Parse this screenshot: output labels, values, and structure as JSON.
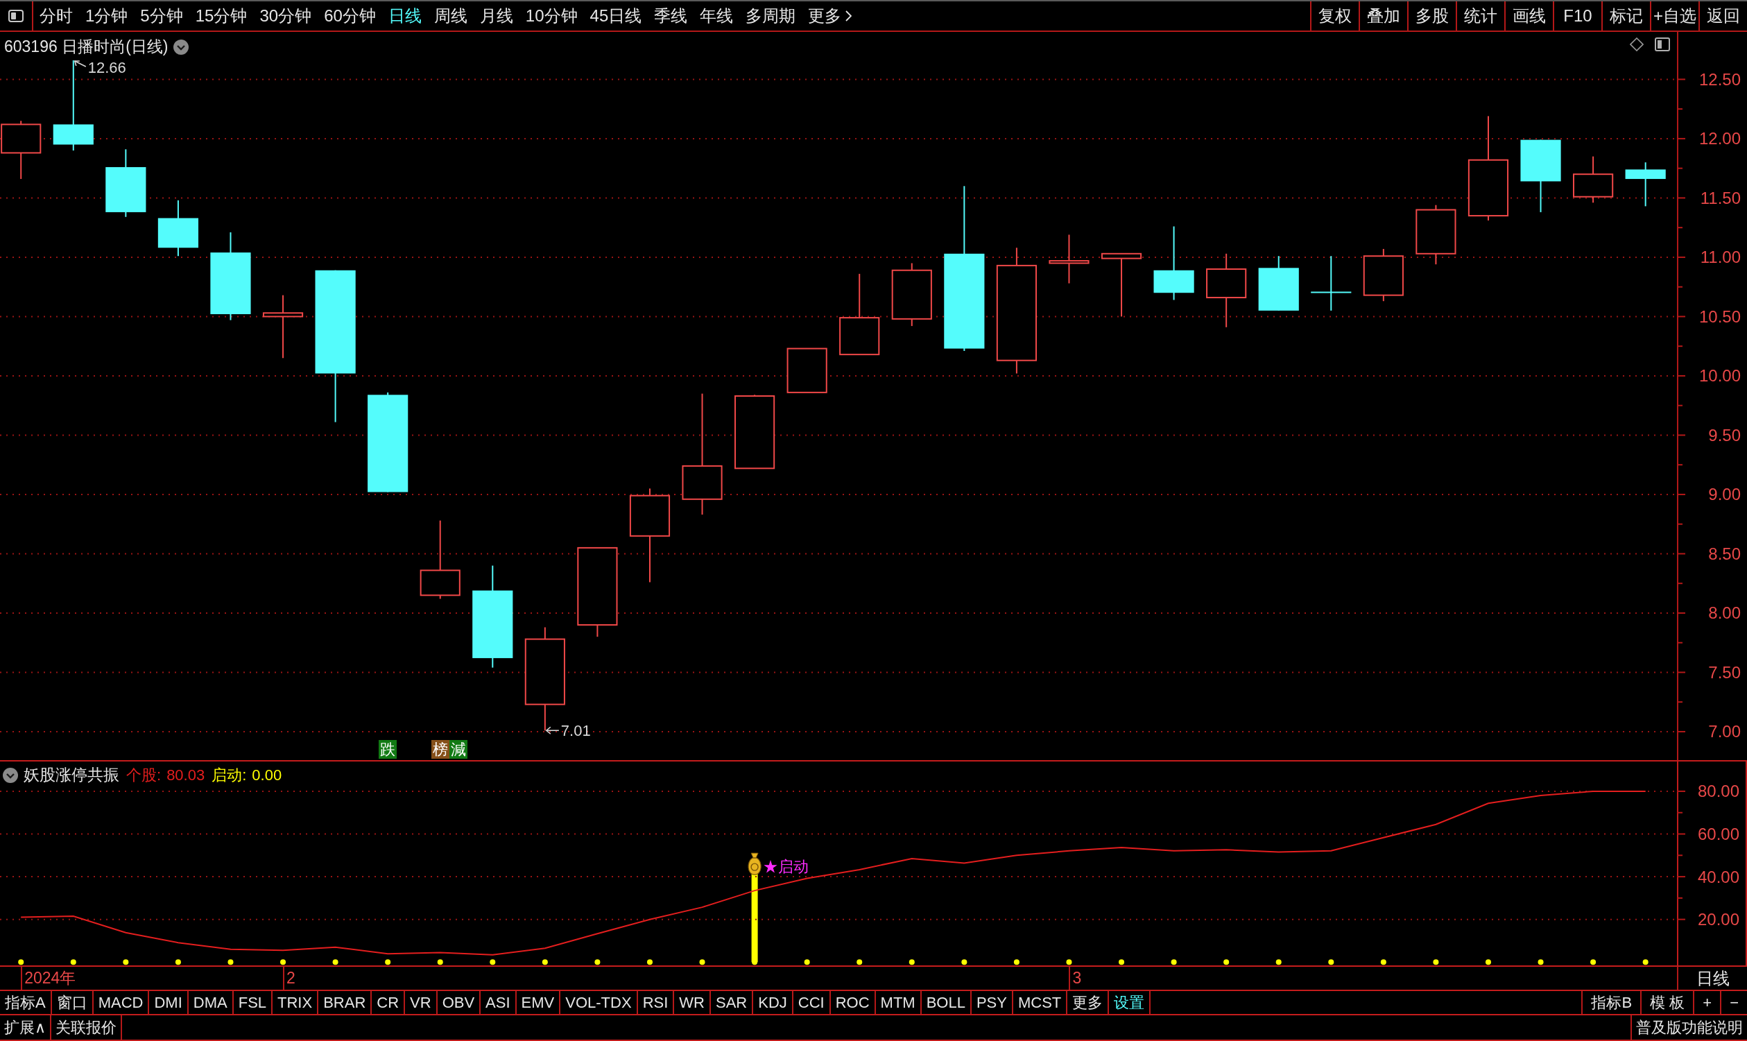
{
  "toolbar": {
    "periods": [
      {
        "label": "分时",
        "selected": false,
        "kind": "period"
      },
      {
        "label": "1分钟",
        "selected": false,
        "kind": "period"
      },
      {
        "label": "5分钟",
        "selected": false,
        "kind": "period"
      },
      {
        "label": "15分钟",
        "selected": false,
        "kind": "period"
      },
      {
        "label": "30分钟",
        "selected": false,
        "kind": "period"
      },
      {
        "label": "60分钟",
        "selected": false,
        "kind": "period"
      },
      {
        "label": "日线",
        "selected": true,
        "kind": "period"
      },
      {
        "label": "周线",
        "selected": false,
        "kind": "period"
      },
      {
        "label": "月线",
        "selected": false,
        "kind": "period"
      },
      {
        "label": "10分钟",
        "selected": false,
        "kind": "period"
      },
      {
        "label": "45日线",
        "selected": false,
        "kind": "period"
      },
      {
        "label": "季线",
        "selected": false,
        "kind": "period"
      },
      {
        "label": "年线",
        "selected": false,
        "kind": "period"
      },
      {
        "label": "多周期",
        "selected": false,
        "kind": "period"
      },
      {
        "label": "更多",
        "selected": false,
        "kind": "menu"
      }
    ],
    "actions": [
      "复权",
      "叠加",
      "多股",
      "统计",
      "画线",
      "F10",
      "标记",
      "+自选",
      "返回"
    ]
  },
  "main_chart": {
    "title": "603196 日播时尚(日线)",
    "price_scale": [
      "12.50",
      "12.00",
      "11.50",
      "11.00",
      "10.50",
      "10.00",
      "9.50",
      "9.00",
      "8.50",
      "8.00",
      "7.50",
      "7.00"
    ],
    "price_marks": [
      {
        "kind": "high",
        "text": "12.66"
      },
      {
        "kind": "low",
        "text": "7.01"
      }
    ],
    "signal_tags": [
      {
        "tags": [
          {
            "text": "跌",
            "color": "#127a14"
          }
        ]
      },
      {
        "tags": [
          {
            "text": "榜",
            "color": "#86501a"
          },
          {
            "text": "減",
            "color": "#127a14"
          }
        ]
      }
    ]
  },
  "indicator": {
    "title": "妖股涨停共振",
    "readings": [
      "80.03"
    ],
    "signal": {
      "name": "启动:",
      "reading": "0.00",
      "color": "#ffff00"
    },
    "chart_data": {
      "type": "line",
      "series": [
        {
          "name": "个股:",
          "color": "#e41e1e",
          "values": [
            21.0,
            21.5,
            13.8,
            9.1,
            6.0,
            5.5,
            7.0,
            3.9,
            4.5,
            3.4,
            6.5,
            13.3,
            20.0,
            25.7,
            33.5,
            39.2,
            43.3,
            48.5,
            46.4,
            50.0,
            52.1,
            53.7,
            52.1,
            52.6,
            51.6,
            52.1,
            58.3,
            64.5,
            74.4,
            78.0,
            80.0,
            80.0
          ]
        }
      ],
      "ylim": [
        -2.2,
        94.6
      ],
      "yticks": [
        {
          "value": 80,
          "label": "80.00"
        },
        {
          "value": 60,
          "label": "60.00"
        },
        {
          "value": 40,
          "label": "40.00"
        },
        {
          "value": 20,
          "label": "20.00"
        }
      ],
      "grid": true,
      "annotations": [
        "★启动"
      ]
    }
  },
  "date_axis": {
    "labels": [
      "2024年",
      "2",
      "3"
    ],
    "period_label": "日线"
  },
  "indicator_tabs": {
    "left": [
      {
        "label": "指标A",
        "highlighted": false
      },
      {
        "label": "窗口",
        "highlighted": false
      },
      {
        "label": "MACD",
        "highlighted": false
      },
      {
        "label": "DMI",
        "highlighted": false
      },
      {
        "label": "DMA",
        "highlighted": false
      },
      {
        "label": "FSL",
        "highlighted": false
      },
      {
        "label": "TRIX",
        "highlighted": false
      },
      {
        "label": "BRAR",
        "highlighted": false
      },
      {
        "label": "CR",
        "highlighted": false
      },
      {
        "label": "VR",
        "highlighted": false
      },
      {
        "label": "OBV",
        "highlighted": false
      },
      {
        "label": "ASI",
        "highlighted": false
      },
      {
        "label": "EMV",
        "highlighted": false
      },
      {
        "label": "VOL-TDX",
        "highlighted": false
      },
      {
        "label": "RSI",
        "highlighted": false
      },
      {
        "label": "WR",
        "highlighted": false
      },
      {
        "label": "SAR",
        "highlighted": false
      },
      {
        "label": "KDJ",
        "highlighted": false
      },
      {
        "label": "CCI",
        "highlighted": false
      },
      {
        "label": "ROC",
        "highlighted": false
      },
      {
        "label": "MTM",
        "highlighted": false
      },
      {
        "label": "BOLL",
        "highlighted": false
      },
      {
        "label": "PSY",
        "highlighted": false
      },
      {
        "label": "MCST",
        "highlighted": false
      },
      {
        "label": "更多",
        "highlighted": false
      },
      {
        "label": "设置",
        "highlighted": true
      }
    ],
    "right": [
      "指标B",
      "模 板",
      "+",
      "−"
    ]
  },
  "footer": {
    "left": [
      "扩展∧",
      "关联报价"
    ],
    "right": [
      "普及版功能说明"
    ]
  }
}
